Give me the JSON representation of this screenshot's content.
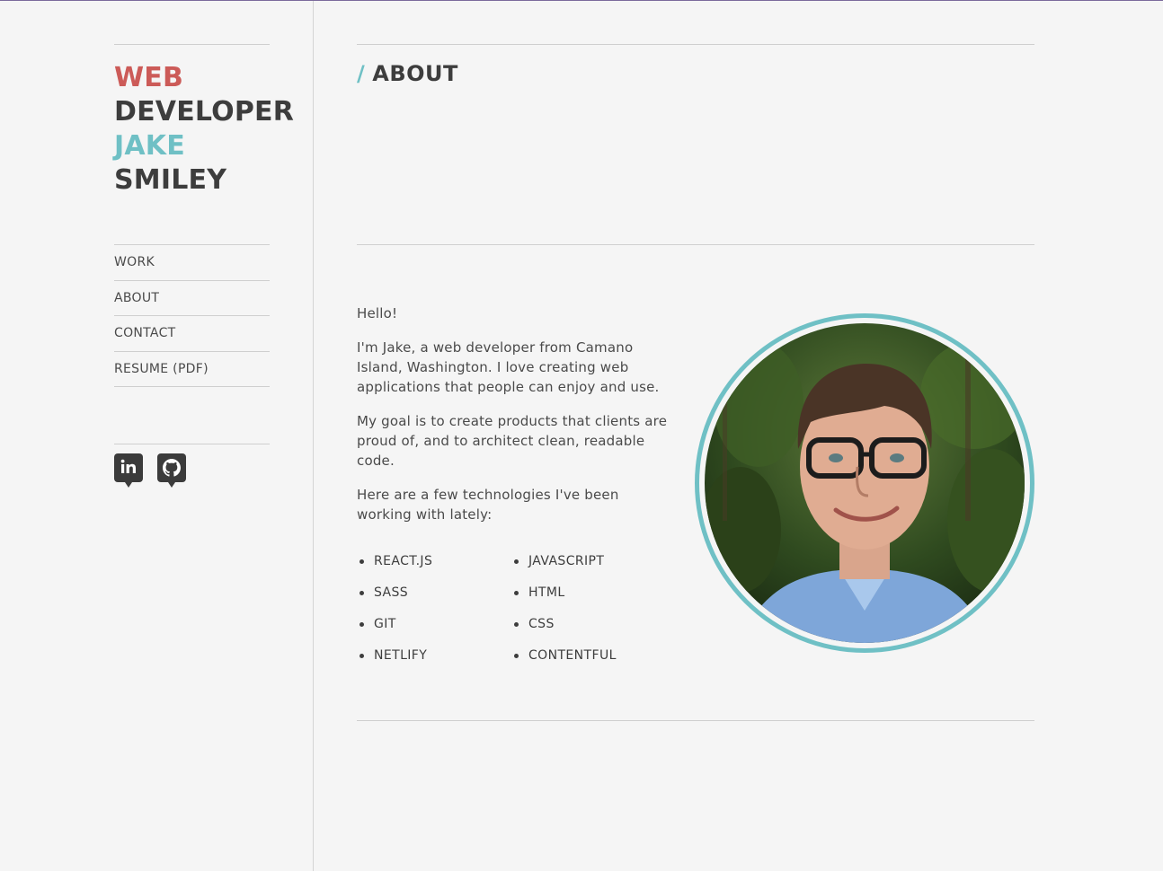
{
  "sidebar": {
    "brand": {
      "line1": "WEB",
      "line2": "DEVELOPER",
      "line3": "JAKE",
      "line4": "SMILEY"
    },
    "nav": [
      {
        "label": "WORK"
      },
      {
        "label": "ABOUT"
      },
      {
        "label": "CONTACT"
      },
      {
        "label": "RESUME (PDF)"
      }
    ],
    "social": [
      {
        "icon": "linkedin-icon"
      },
      {
        "icon": "github-icon"
      }
    ]
  },
  "main": {
    "title_slash": "/",
    "title": "ABOUT",
    "paragraphs": [
      "Hello!",
      "I'm Jake, a web developer from Camano Island, Washington. I love creating web applications that people can enjoy and use.",
      "My goal is to create products that clients are proud of, and to architect clean, readable code.",
      "Here are a few technologies I've been working with lately:"
    ],
    "technologies": [
      "REACT.JS",
      "JAVASCRIPT",
      "SASS",
      "HTML",
      "GIT",
      "CSS",
      "NETLIFY",
      "CONTENTFUL"
    ]
  },
  "colors": {
    "accent_red": "#cc5b58",
    "accent_teal": "#6fc0c5",
    "text": "#3d3d3d",
    "background": "#f5f5f5"
  }
}
